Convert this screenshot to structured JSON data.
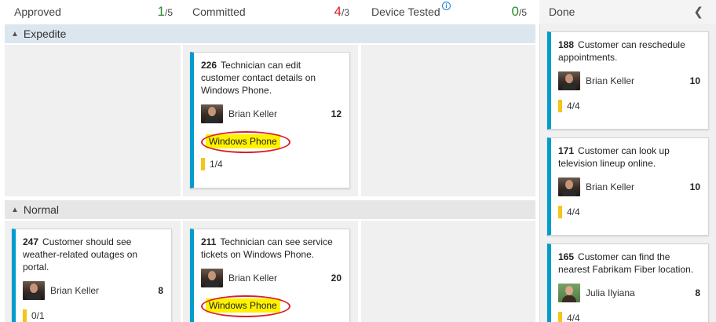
{
  "columns": {
    "approved": {
      "name": "Approved",
      "count": "1",
      "limit": "/5"
    },
    "committed": {
      "name": "Committed",
      "count": "4",
      "limit": "/3"
    },
    "device_tested": {
      "name": "Device Tested",
      "info_icon": "info-icon",
      "count": "0",
      "limit": "/5"
    },
    "done": {
      "name": "Done",
      "collapse_icon": "chevron-left-icon"
    }
  },
  "lanes": {
    "expedite": {
      "label": "Expedite"
    },
    "normal": {
      "label": "Normal"
    }
  },
  "cards": {
    "c226": {
      "id": "226",
      "title": "Technician can edit customer contact details on Windows Phone.",
      "assignee": "Brian Keller",
      "points": "12",
      "tag": "Windows Phone",
      "tasks": "1/4"
    },
    "c247": {
      "id": "247",
      "title": "Customer should see weather-related outages on portal.",
      "assignee": "Brian Keller",
      "points": "8",
      "tasks": "0/1"
    },
    "c211": {
      "id": "211",
      "title": "Technician can see service tickets on Windows Phone.",
      "assignee": "Brian Keller",
      "points": "20",
      "tag": "Windows Phone"
    },
    "c188": {
      "id": "188",
      "title": "Customer can reschedule appointments.",
      "assignee": "Brian Keller",
      "points": "10",
      "tasks": "4/4"
    },
    "c171": {
      "id": "171",
      "title": "Customer can look up television lineup online.",
      "assignee": "Brian Keller",
      "points": "10",
      "tasks": "4/4"
    },
    "c165": {
      "id": "165",
      "title": "Customer can find the nearest Fabrikam Fiber location.",
      "assignee": "Julia Ilyiana",
      "points": "8",
      "tasks": "4/4"
    }
  },
  "colors": {
    "card_accent": "#009ccc",
    "tag_highlight": "#fff200",
    "annotation_ring": "#d8202c",
    "limit_ok": "#2e8b2e",
    "limit_exceeded": "#d92424"
  }
}
